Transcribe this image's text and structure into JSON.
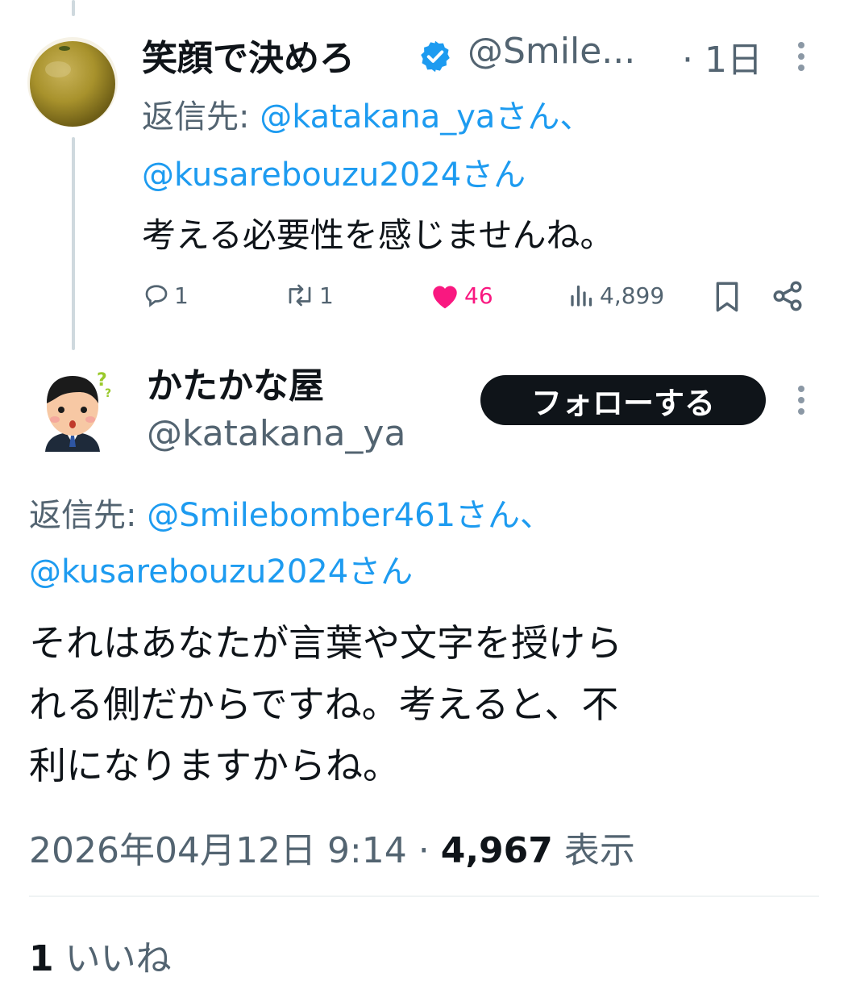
{
  "parent_tweet": {
    "display_name": "笑顔で決めろ",
    "handle_truncated": "@Smile...",
    "time_ago": "· 1日",
    "reply_to_label": "返信先:",
    "reply_to_users": [
      "@katakana_yaさん、",
      "@kusarebouzu2024さん"
    ],
    "text": "考える必要性を感じませんね。",
    "stats": {
      "replies": "1",
      "retweets": "1",
      "likes": "46",
      "views": "4,899"
    }
  },
  "main_tweet": {
    "display_name": "かたかな屋",
    "handle": "@katakana_ya",
    "follow_label": "フォローする",
    "reply_to_label": "返信先:",
    "reply_to_users": [
      "@Smilebomber461さん、",
      "@kusarebouzu2024さん"
    ],
    "text_lines": [
      "それはあなたが言葉や文字を授けら",
      "れる側だからですね。考えると、不",
      "利になりますからね。"
    ],
    "date": "2026年04月12日 9:14 ·",
    "view_count": "4,967",
    "view_label": "表示",
    "like_count": "1",
    "like_label": "いいね"
  },
  "colors": {
    "link": "#1d9bf0",
    "like": "#f91880",
    "secondary": "#536471",
    "follow_bg": "#0f1419"
  }
}
